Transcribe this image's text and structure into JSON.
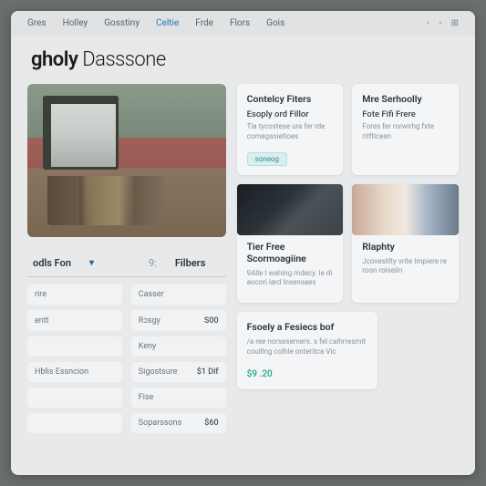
{
  "nav": {
    "items": [
      "Gres",
      "Holley",
      "Gosstiny",
      "Celtie",
      "Frde",
      "Flors",
      "Gois"
    ],
    "activeIndex": 3
  },
  "brand": {
    "bold": "gholy",
    "light": " Dasssone"
  },
  "filters": {
    "col1_label": "odls Fon",
    "col2_label": "Filbers",
    "col2_prefix": "9:",
    "rows": [
      {
        "l": "rire",
        "r": "Casser",
        "rv": ""
      },
      {
        "l": "entt",
        "r": "Rɔsgy",
        "rv": "S00"
      },
      {
        "l": "",
        "r": "Keny",
        "rv": ""
      },
      {
        "l": "Hblis Essncion",
        "r": "Sigostsure",
        "rv": "$1 Dif"
      },
      {
        "l": "",
        "r": "Fise",
        "rv": ""
      },
      {
        "l": "",
        "r": "Soparssons",
        "rv": "$60"
      }
    ]
  },
  "cards": {
    "topLeft": {
      "title": "Contelcy Fiters",
      "sub": "Esoply ord Fillor",
      "desc": "Tia tycostese ura fer rde comegsnietioes",
      "tag": "soneog"
    },
    "topRight": {
      "title": "Mre Serhoolly",
      "sub": "Fote Fifi Frere",
      "desc": "Fores fer rorwirhg fxte ritftlceen"
    },
    "midLeft": {
      "title": "Tier Free Scormoagiine",
      "desc": "9Alle I wahing mdecy. le di aocori lard Insensaes"
    },
    "midRight": {
      "title": "Rlaphty",
      "desc": "Jcoveslilty vrite Impiere re roon rolseiln"
    },
    "bottom": {
      "title": "Fsoely a Fesiecs bof",
      "desc": "/a ree norsesemers. s fel calhrresmit coulllng colhle onteritca Vic",
      "price": "$9 .20"
    }
  }
}
